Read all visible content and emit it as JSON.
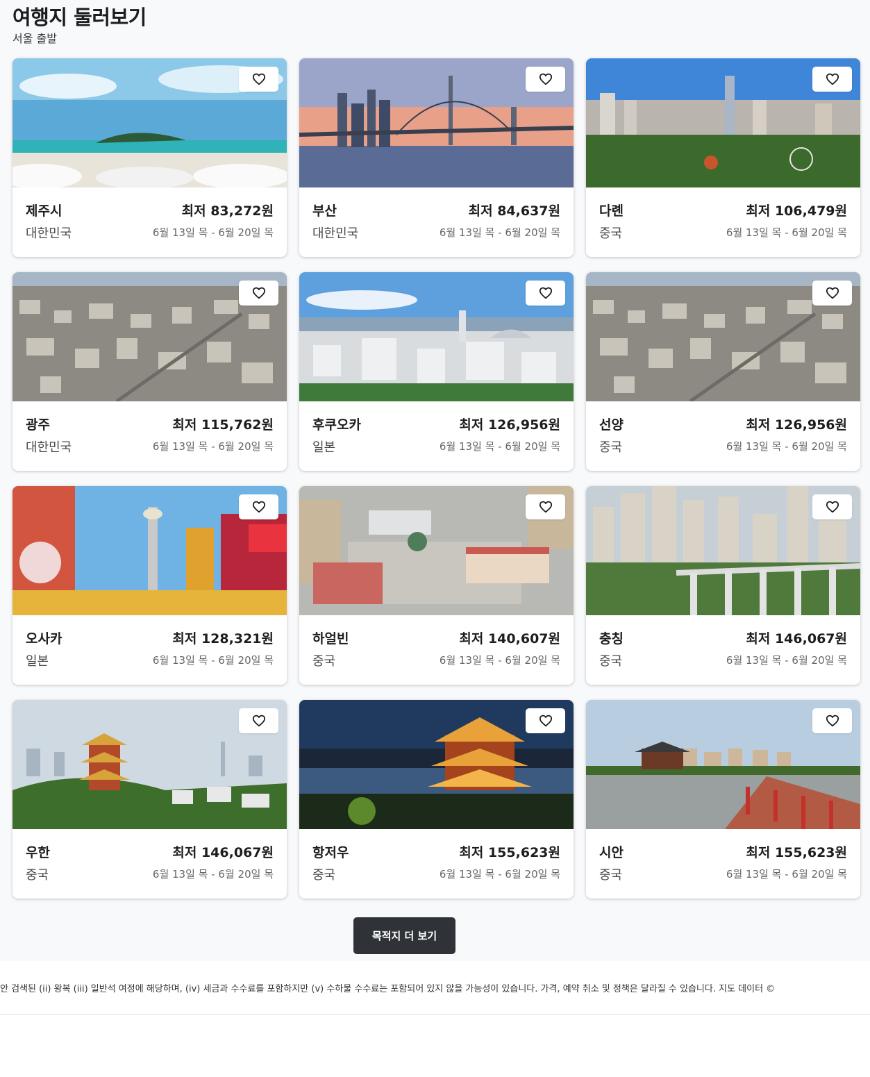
{
  "header": {
    "title": "여행지 둘러보기",
    "subtitle": "서울 출발"
  },
  "destinations": [
    {
      "city": "제주시",
      "country": "대한민국",
      "price": "최저 83,272원",
      "dates": "6월 13일 목 - 6월 20일 목",
      "photo": "beach-island-photo"
    },
    {
      "city": "부산",
      "country": "대한민국",
      "price": "최저 84,637원",
      "dates": "6월 13일 목 - 6월 20일 목",
      "photo": "bridge-skyline-photo"
    },
    {
      "city": "다롄",
      "country": "중국",
      "price": "최저 106,479원",
      "dates": "6월 13일 목 - 6월 20일 목",
      "photo": "city-park-photo"
    },
    {
      "city": "광주",
      "country": "대한민국",
      "price": "최저 115,762원",
      "dates": "6월 13일 목 - 6월 20일 목",
      "photo": "aerial-city-photo"
    },
    {
      "city": "후쿠오카",
      "country": "일본",
      "price": "최저 126,956원",
      "dates": "6월 13일 목 - 6월 20일 목",
      "photo": "waterfront-city-photo"
    },
    {
      "city": "선양",
      "country": "중국",
      "price": "최저 126,956원",
      "dates": "6월 13일 목 - 6월 20일 목",
      "photo": "aerial-city-photo"
    },
    {
      "city": "오사카",
      "country": "일본",
      "price": "최저 128,321원",
      "dates": "6월 13일 목 - 6월 20일 목",
      "photo": "tower-street-photo"
    },
    {
      "city": "하얼빈",
      "country": "중국",
      "price": "최저 140,607원",
      "dates": "6월 13일 목 - 6월 20일 목",
      "photo": "cathedral-square-photo"
    },
    {
      "city": "충칭",
      "country": "중국",
      "price": "최저 146,067원",
      "dates": "6월 13일 목 - 6월 20일 목",
      "photo": "monorail-highrise-photo"
    },
    {
      "city": "우한",
      "country": "중국",
      "price": "최저 146,067원",
      "dates": "6월 13일 목 - 6월 20일 목",
      "photo": "pagoda-hill-photo"
    },
    {
      "city": "항저우",
      "country": "중국",
      "price": "최저 155,623원",
      "dates": "6월 13일 목 - 6월 20일 목",
      "photo": "night-pagoda-photo"
    },
    {
      "city": "시안",
      "country": "중국",
      "price": "최저 155,623원",
      "dates": "6월 13일 목 - 6월 20일 목",
      "photo": "lake-pavilion-photo"
    }
  ],
  "more_button": {
    "label": "목적지 더 보기"
  },
  "footer": {
    "disclaimer": "안 검색된 (ii) 왕복 (iii) 일반석 여정에 해당하며, (iv) 세금과 수수료를 포함하지만 (v) 수하물 수수료는 포함되어 있지 않을 가능성이 있습니다. 가격, 예약 취소 및 정책은 달라질 수 있습니다. 지도 데이터 ©"
  },
  "icons": {
    "favorite": "heart-outline-icon"
  },
  "colors": {
    "button_bg": "#2f3338",
    "section_bg": "#f8f9fb",
    "card_bg": "#ffffff"
  }
}
